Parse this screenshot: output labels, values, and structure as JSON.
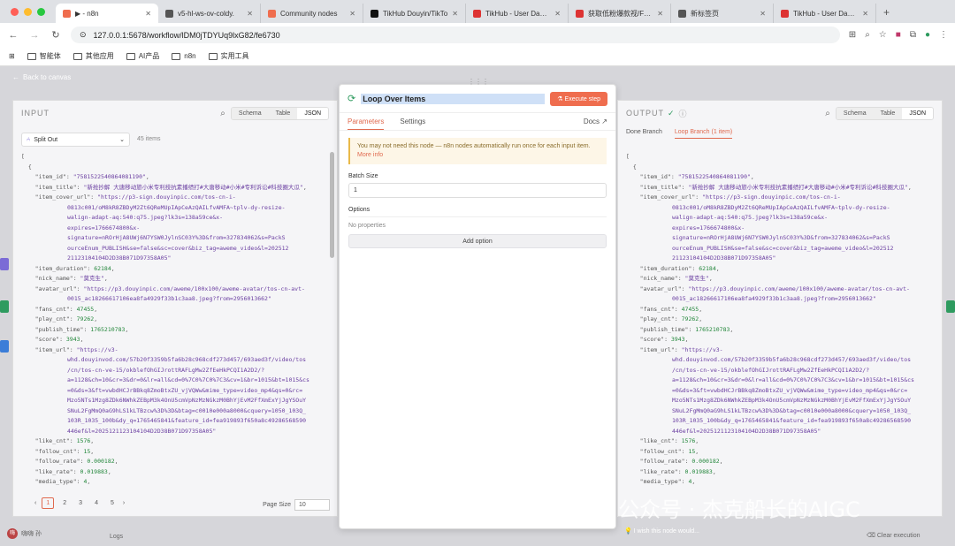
{
  "browser": {
    "tabs": [
      {
        "label": "▶ - n8n",
        "active": true,
        "color": "#ef6d4e"
      },
      {
        "label": "v5-hl-ws-ov-coldy.",
        "active": false,
        "color": "#555"
      },
      {
        "label": "Community nodes",
        "active": false,
        "color": "#ef6d4e"
      },
      {
        "label": "TikHub Douyin/TikTo",
        "active": false,
        "color": "#111"
      },
      {
        "label": "TikHub - User Dashb",
        "active": false,
        "color": "#d33"
      },
      {
        "label": "获取低粉爆款视/Fetch",
        "active": false,
        "color": "#d33"
      },
      {
        "label": "新标签页",
        "active": false,
        "color": "#555"
      },
      {
        "label": "TikHub - User Dashb",
        "active": false,
        "color": "#d33"
      }
    ],
    "url": "127.0.0.1:5678/workflow/lDM0jTDYUq9lxG82/fe6730",
    "bookmarks": [
      "智能体",
      "其他应用",
      "AI产品",
      "n8n",
      "实用工具"
    ]
  },
  "canvas": {
    "back_label": "Back to canvas"
  },
  "input_panel": {
    "title": "INPUT",
    "view_tabs": [
      "Schema",
      "Table",
      "JSON"
    ],
    "node_select": "Split Out",
    "item_count": "45 items",
    "pages": [
      "1",
      "2",
      "3",
      "4",
      "5"
    ],
    "page_size_label": "Page Size",
    "page_size": "10"
  },
  "output_panel": {
    "title": "OUTPUT",
    "view_tabs": [
      "Schema",
      "Table",
      "JSON"
    ],
    "branch_tabs": [
      "Done Branch",
      "Loop Branch (1 item)"
    ]
  },
  "json_record": {
    "item_id": "\"7581522540864081190\"",
    "item_title": "\"新抢抄解 大唐移动旅小米专利技抗素播绩打#大唐移动#小米#专利诉讼#科技圈大瓜\"",
    "item_cover_url_lines": [
      "\"https://p3-sign.douyinpic.com/tos-cn-i-",
      "0813c001/oM8kR8ZBDyM2Zt6QReMUpIApCeAzQAILfvAMFA~tplv-dy-resize-",
      "walign-adapt-aq:540:q75.jpeg?lk3s=138a59ce&x-",
      "expires=1766674800&x-",
      "signature=nROrHjA8UWj6N7YSW0JylnSC03Y%3D&from=327834062&s=PackS",
      "ourceEnum_PUBLISH&se=false&sc=cover&biz_tag=aweme_video&l=202512",
      "21123104104D2D38B071D97358A05\""
    ],
    "item_duration": "62184",
    "nick_name": "\"莫克生\"",
    "avatar_url_lines": [
      "\"https://p3.douyinpic.com/aweme/100x100/aweme-avatar/tos-cn-avt-",
      "0015_ac18266617106ea8fa4929f33b1c3aa8.jpeg?from=2956013662\""
    ],
    "fans_cnt": "47455",
    "play_cnt": "79262",
    "publish_time": "1765210783",
    "score": "3943",
    "item_url_lines": [
      "\"https://v3-",
      "whd.douyinvod.com/57b20f3359b5fa6b28c968cdf273d457/693aed3f/video/tos",
      "/cn/tos-cn-ve-15/okblefOhGIJrottRAFLgMw2ZfEeHkPCQI1A2D2/?",
      "a=1128&ch=10&cr=3&dr=0&lr=all&cd=0%7C0%7C0%7C3&cv=1&br=1015&bt=1015&cs",
      "=0&ds=3&ft=vwbdHCJrBBkq8ZmoBtxZU_vjVQWw&mime_type=video_mp4&qs=0&rc=",
      "Mzo5NTs1Mzg8ZDk6NWhkZEBpM3k4OnU5cmVpNzMzNGkzM0BhYjEvM2FfXmExYjJgYSOuY",
      "SNuL2FgMmQ0aG9hLS1kLTBzcw%3D%3D&btag=c0010e000a8000&cquery=1050_103Q_",
      "103R_1035_100b&dy_q=1765465841&feature_id=fea919893f650a8c49286568590",
      "446ef&l=2025121123104104D2D38B071D97358A05\""
    ],
    "like_cnt": "1576",
    "follow_cnt": "15",
    "follow_rate": "0.000182",
    "like_rate": "0.019883",
    "media_type": "4"
  },
  "node_panel": {
    "name": "Loop Over Items",
    "execute_label": "Execute step",
    "tabs": [
      "Parameters",
      "Settings"
    ],
    "docs_label": "Docs",
    "notice_text": "You may not need this node — n8n nodes automatically run once for each input item.",
    "notice_link": "More info",
    "batch_size_label": "Batch Size",
    "batch_size_value": "1",
    "options_label": "Options",
    "no_properties": "No properties",
    "add_option_label": "Add option"
  },
  "bottom": {
    "user_name": "嗨嗨 孙",
    "logs_label": "Logs",
    "wish_label": "I wish this node would...",
    "clear_label": "Clear execution"
  },
  "watermark": "公众号 · 杰克船长的AIGC",
  "colors": {
    "accent": "#ef6d4e",
    "string": "#6a3ea1",
    "number": "#22863a",
    "success": "#2e9b5f"
  }
}
